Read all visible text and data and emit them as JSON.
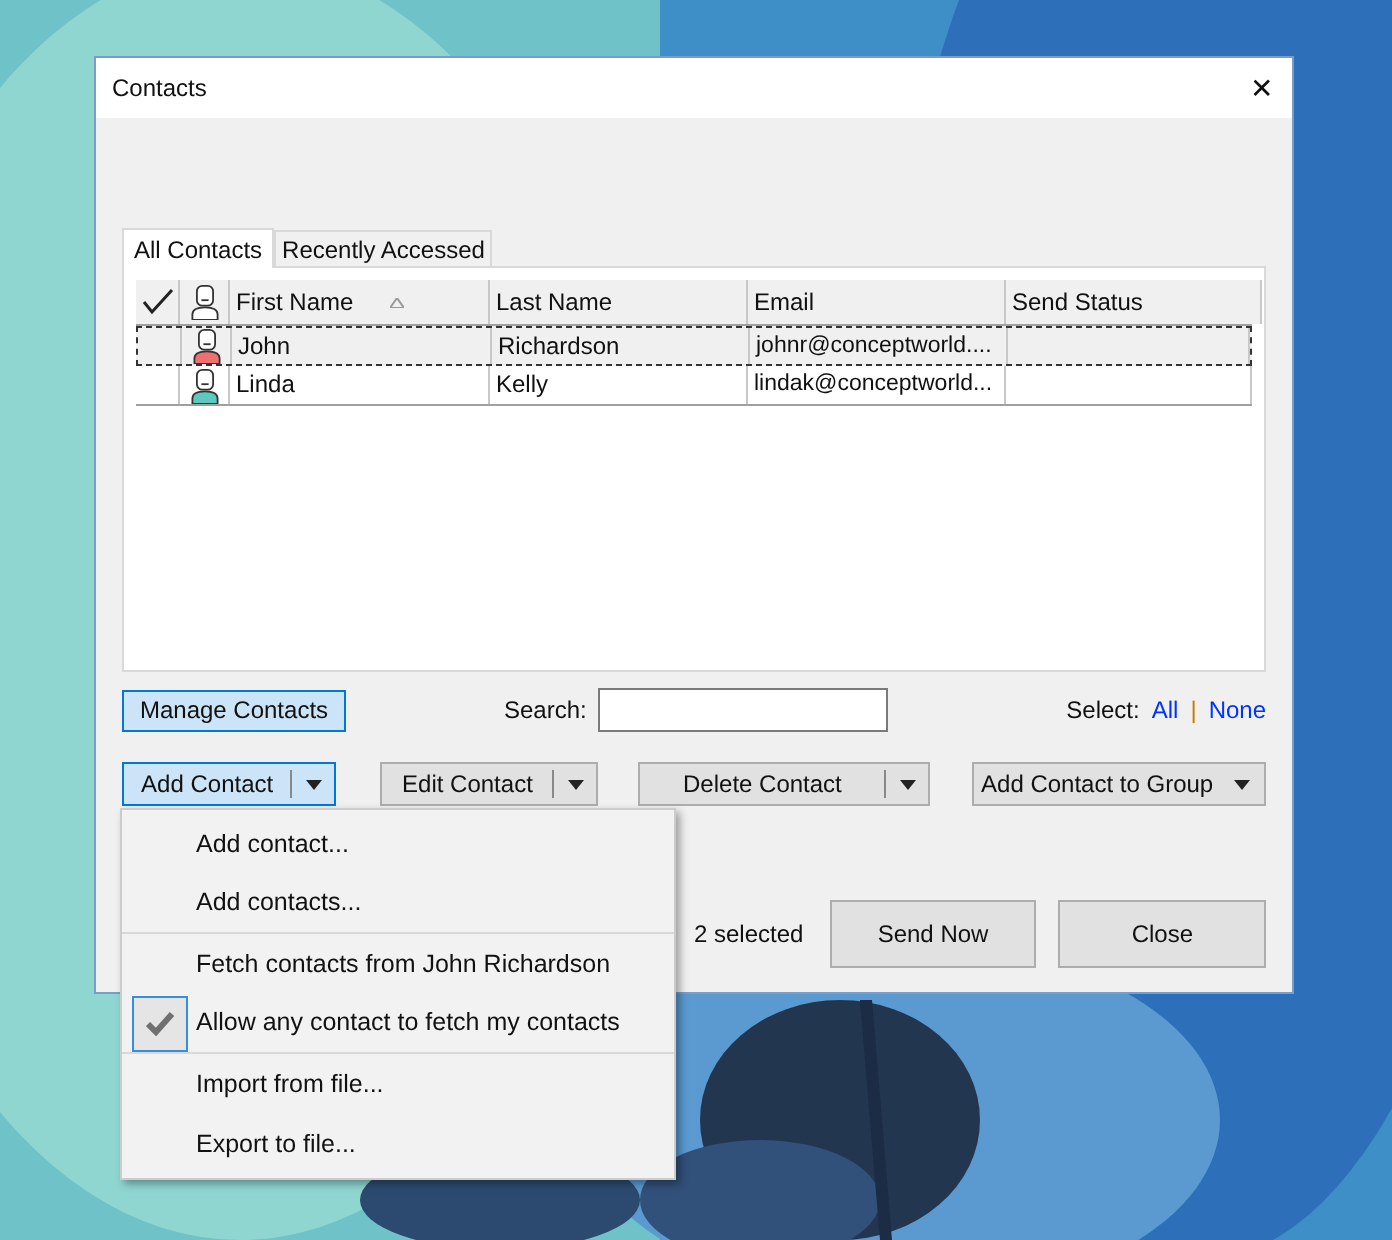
{
  "window": {
    "title": "Contacts",
    "close": "✕"
  },
  "tabs": [
    {
      "label": "All Contacts",
      "selected": true
    },
    {
      "label": "Recently Accessed",
      "selected": false
    }
  ],
  "table": {
    "columns": [
      {
        "kind": "check"
      },
      {
        "kind": "avatar"
      },
      {
        "kind": "text",
        "label": "First Name",
        "sorted": true
      },
      {
        "kind": "text",
        "label": "Last Name",
        "sorted": false
      },
      {
        "kind": "text",
        "label": "Email",
        "sorted": false
      },
      {
        "kind": "text",
        "label": "Send Status",
        "sorted": false
      }
    ],
    "rows": [
      {
        "first": "John",
        "last": "Richardson",
        "email": "johnr@conceptworld....",
        "selected": true,
        "color": "#f07070"
      },
      {
        "first": "Linda",
        "last": "Kelly",
        "email": "lindak@conceptworld...",
        "selected": false,
        "color": "#5cc8c0"
      }
    ]
  },
  "manage_button": "Manage Contacts",
  "search": {
    "label": "Search:"
  },
  "select": {
    "label": "Select:",
    "all": "All",
    "separator": "|",
    "none": "None"
  },
  "action_buttons": [
    {
      "label": "Add Contact",
      "focused": true
    },
    {
      "label": "Edit Contact",
      "focused": false
    },
    {
      "label": "Delete Contact",
      "focused": false
    },
    {
      "label": "Add Contact to Group",
      "focused": false
    }
  ],
  "selection_count": "2 selected",
  "footer_buttons": [
    "Send Now",
    "Close"
  ],
  "menu": [
    {
      "label": "Add contact...",
      "checked": false,
      "separator_after": false
    },
    {
      "label": "Add contacts...",
      "checked": false,
      "separator_after": true
    },
    {
      "label": "Fetch contacts from John Richardson",
      "checked": false,
      "separator_after": false
    },
    {
      "label": "Allow any contact to fetch my contacts",
      "checked": true,
      "separator_after": true
    },
    {
      "label": "Import from file...",
      "checked": false,
      "separator_after": false
    },
    {
      "label": "Export to file...",
      "checked": false,
      "separator_after": false
    }
  ]
}
